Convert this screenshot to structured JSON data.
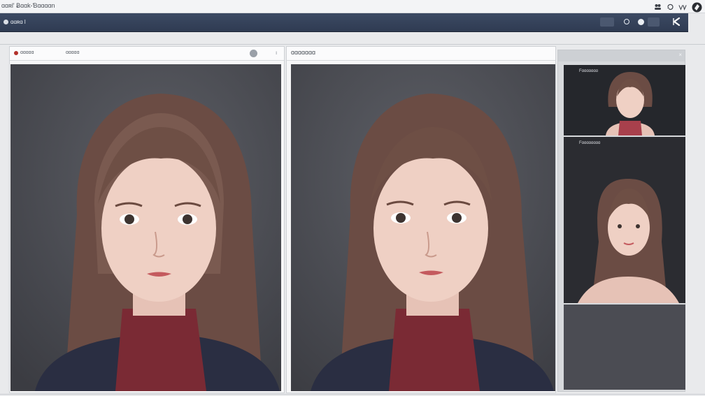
{
  "window": {
    "title": "ɑɑʀl' Ƀɑɑk-Ɓɑɑɑɑn"
  },
  "toolbar": {
    "label": "ɑɑʀɑ l"
  },
  "left_panel": {
    "header_left": "ɑɑɑɑɑ",
    "header_mid": "ɑɑɑɑɑ",
    "header_right": "ı"
  },
  "right_panel": {
    "header": "ɑɑɑɑɑɑɑ"
  },
  "side_panel": {
    "close": "×",
    "thumbs": [
      {
        "label": "Fɑɑɑɑɑɑɑ"
      },
      {
        "label": "Fɑɑɑɑɑɑɑɑ"
      }
    ]
  },
  "colors": {
    "toolbar_bg": "#34415a",
    "window_bg": "#e9eaec",
    "photo_bg": "#4f5158",
    "sweater": "#7a2a34"
  }
}
